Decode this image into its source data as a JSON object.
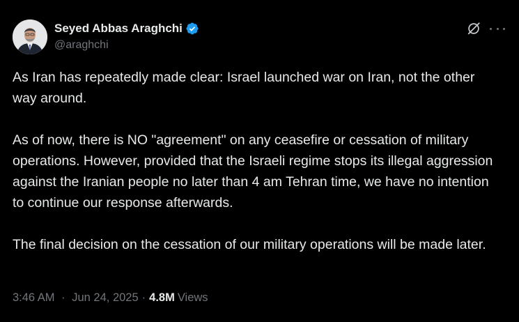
{
  "author": {
    "name": "Seyed Abbas Araghchi",
    "handle": "@araghchi",
    "verified": true
  },
  "icons": {
    "avatar": "avatar",
    "verified": "verified-badge-icon",
    "grok": "grok-icon",
    "more": "more-options-icon"
  },
  "colors": {
    "background": "#000000",
    "text": "#e7e9ea",
    "secondary": "#71767b",
    "verified": "#1d9bf0"
  },
  "tweet": {
    "paragraphs": [
      "As Iran has repeatedly made clear: Israel launched war on Iran, not the other way around.",
      "As of now, there is NO \"agreement\" on any ceasefire or cessation of military operations. However, provided that the Israeli regime stops its illegal aggression against the Iranian people no later than 4 am Tehran time, we have no intention to continue our response afterwards.",
      "The final decision on the cessation of our military operations will be made later."
    ],
    "time": "3:46 AM",
    "separator": "·",
    "date": "Jun 24, 2025",
    "views_count": "4.8M",
    "views_label": "Views"
  }
}
